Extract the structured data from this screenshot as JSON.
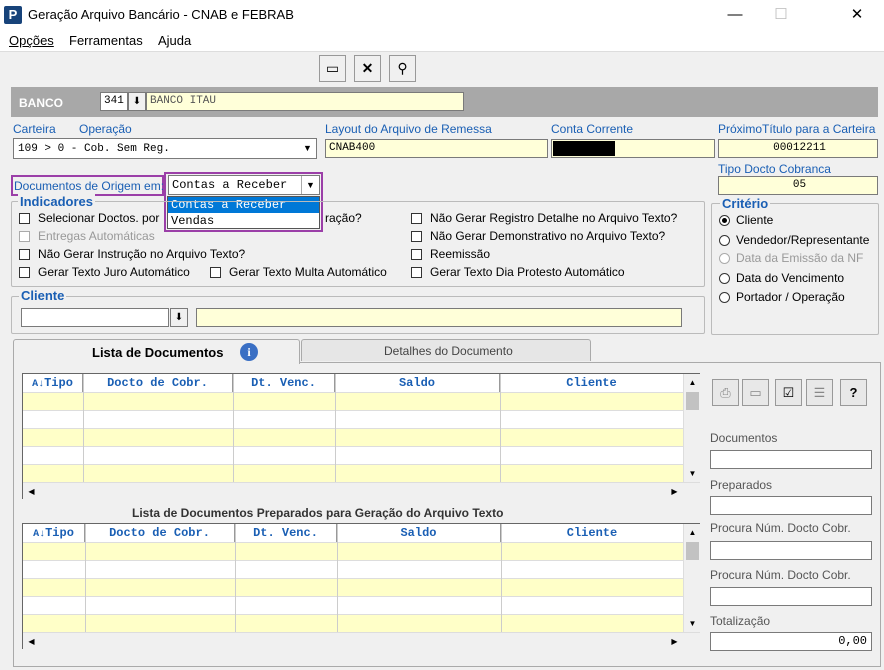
{
  "window": {
    "title": "Geração Arquivo Bancário - CNAB e FEBRAB",
    "app_icon": "P",
    "minimize": "—",
    "maximize": "☐",
    "close": "✕"
  },
  "menu": [
    "Opções",
    "Ferramentas",
    "Ajuda"
  ],
  "banco": {
    "label": "BANCO",
    "code": "341",
    "name": "BANCO ITAU"
  },
  "labels": {
    "carteira": "Carteira",
    "operacao": "Operação",
    "layout": "Layout do Arquivo de Remessa",
    "conta": "Conta Corrente",
    "proximo": "PróximoTítulo para a Carteira",
    "tipo_docto": "Tipo Docto Cobranca",
    "doc_origem": "Documentos de Origem em:",
    "indicadores": "Indicadores",
    "criterio": "Critério",
    "cliente": "Cliente"
  },
  "values": {
    "carteira_op": "109   > 0 - Cob. Sem Reg.",
    "layout": "CNAB400",
    "proximo": "00012211",
    "tipo_docto": "05",
    "doc_origem": "Contas a Receber"
  },
  "dropdown_options": [
    "Contas a Receber",
    "Vendas"
  ],
  "indicadores": {
    "c1": "Selecionar Doctos. por",
    "c1b": "ração?",
    "c2": "Entregas Automáticas",
    "c3": "Não Gerar Instrução no Arquivo Texto?",
    "c4": "Gerar Texto Juro Automático",
    "c5": "Gerar Texto Multa Automático",
    "c6": "Não Gerar Registro Detalhe no Arquivo Texto?",
    "c7": "Não Gerar Demonstrativo no Arquivo Texto?",
    "c8": "Reemissão",
    "c9": "Gerar Texto Dia Protesto Automático"
  },
  "criterio": [
    "Cliente",
    "Vendedor/Representante",
    "Data da Emissão da NF",
    "Data do Vencimento",
    "Portador / Operação"
  ],
  "tabs": {
    "lista": "Lista de Documentos",
    "detalhes": "Detalhes do Documento"
  },
  "grid_columns": [
    "Tipo",
    "Docto de Cobr.",
    "Dt. Venc.",
    "Saldo",
    "Cliente"
  ],
  "grid2_title": "Lista de Documentos Preparados para Geração do Arquivo Texto",
  "right_panel": {
    "documentos": "Documentos",
    "preparados": "Preparados",
    "procura1": "Procura Núm. Docto Cobr.",
    "procura2": "Procura Núm. Docto Cobr.",
    "totalizacao": "Totalização",
    "total_value": "0,00",
    "help": "?"
  }
}
